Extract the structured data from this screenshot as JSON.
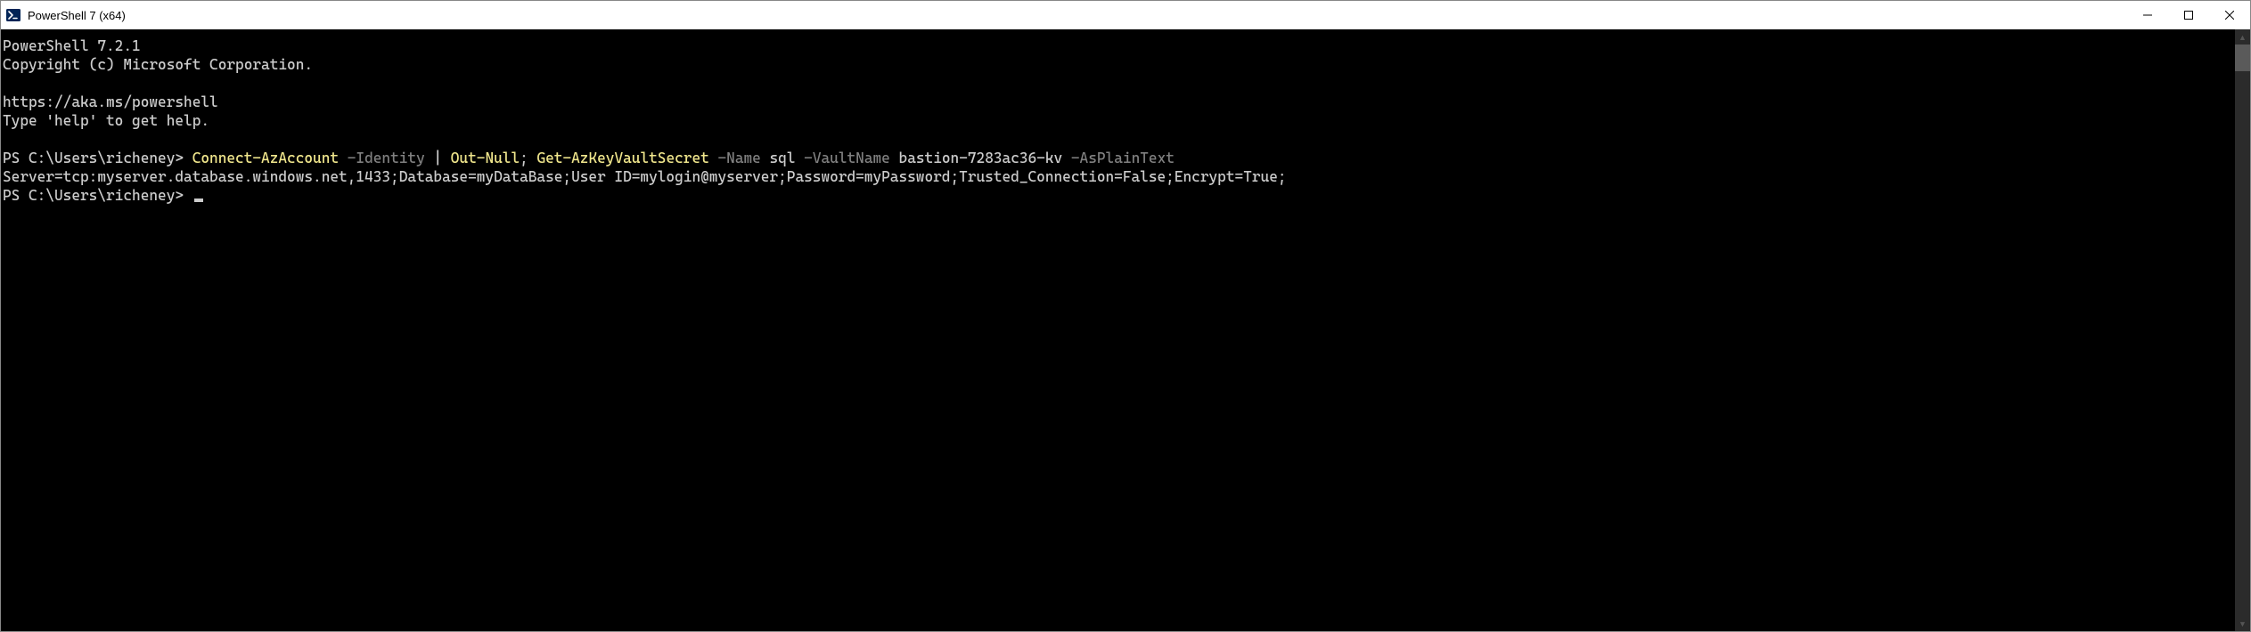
{
  "window": {
    "title": "PowerShell 7 (x64)"
  },
  "terminal": {
    "banner": {
      "version": "PowerShell 7.2.1",
      "copyright": "Copyright (c) Microsoft Corporation.",
      "url": "https://aka.ms/powershell",
      "help": "Type 'help' to get help."
    },
    "prompt1": {
      "prefix": "PS C:\\Users\\richeney> ",
      "cmd1": "Connect-AzAccount",
      "param1": " -Identity",
      "sep1": " | ",
      "cmd2": "Out-Null",
      "sep2": "; ",
      "cmd3": "Get-AzKeyVaultSecret",
      "param2": " -Name",
      "arg2": " sql",
      "param3": " -VaultName",
      "arg3": " bastion-7283ac36-kv",
      "param4": " -AsPlainText"
    },
    "output1": "Server=tcp:myserver.database.windows.net,1433;Database=myDataBase;User ID=mylogin@myserver;Password=myPassword;Trusted_Connection=False;Encrypt=True;",
    "prompt2": {
      "prefix": "PS C:\\Users\\richeney> "
    }
  }
}
